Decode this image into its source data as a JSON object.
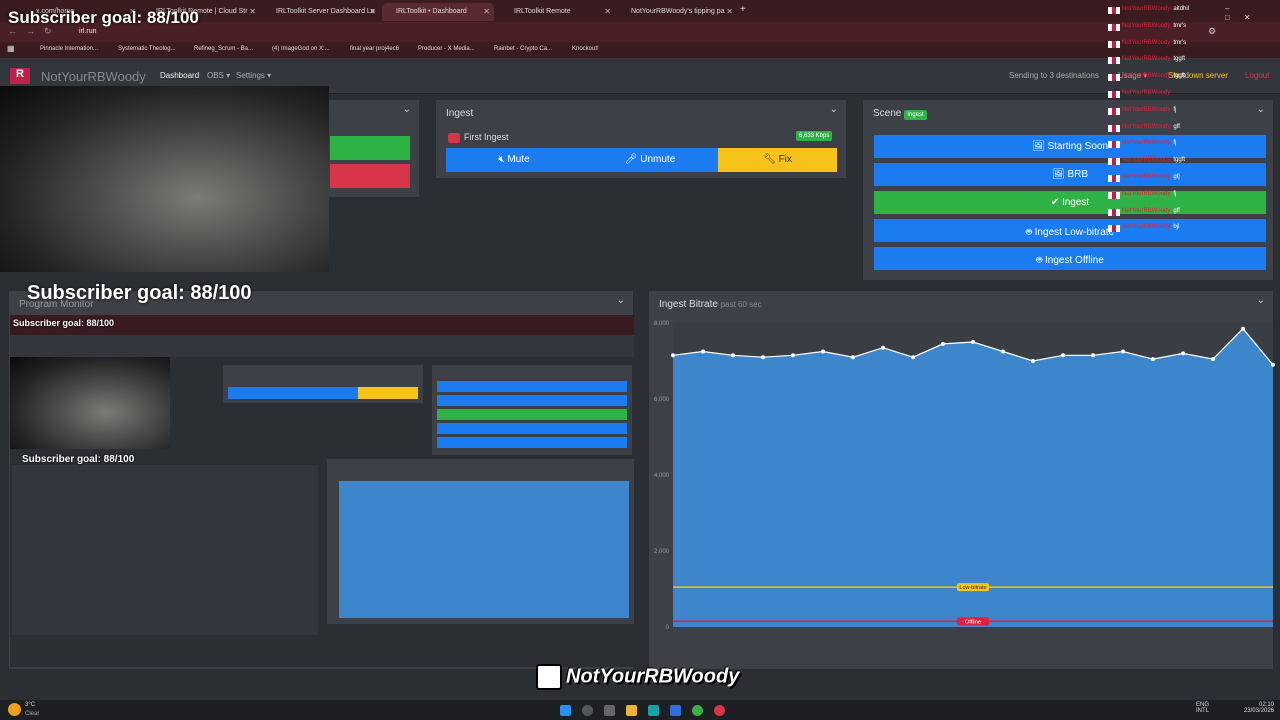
{
  "overlay": {
    "subscriber_goal": "Subscriber goal: 88/100"
  },
  "browser": {
    "tabs": [
      "x.com/home",
      "IRLToolkit Remote | Cloud Str",
      "IRLToolkit Server Dashboard Lo",
      "IRLToolkit • Dashboard",
      "IRLToolkit Remote",
      "NotYourRBWoody's tipping pa"
    ],
    "address": "irl.run",
    "bookmarks": [
      "Pinnacle Internation...",
      "Systematic Theolog...",
      "Refineg_Scrum - Ba...",
      "(4) ImageGod on X:...",
      "final year proj4ec6",
      "Producer - X Media...",
      "Rainbet - Crypto Ca...",
      "Knockout!"
    ]
  },
  "nav": {
    "brand": "NotYourRBWoody",
    "dashboard": "Dashboard",
    "obs": "OBS ▾",
    "settings": "Settings ▾",
    "sending": "Sending to 3 destinations",
    "usage": "Usage ▾",
    "shutdown": "Shutdown server",
    "logout": "Logout"
  },
  "ingest": {
    "title": "Ingest",
    "source": "First Ingest",
    "bitrate": "6,633 Kbps",
    "mute": "Mute",
    "unmute": "Unmute",
    "fix": "Fix"
  },
  "scene": {
    "title": "Scene",
    "badge": "Ingest",
    "buttons": [
      "Starting Soon",
      "BRB",
      "Ingest",
      "Ingest Low-bitrate",
      "Ingest Offline"
    ]
  },
  "program": {
    "title": "Program Monitor"
  },
  "bitrate": {
    "title": "Ingest Bitrate",
    "subtitle": "past 60 sec",
    "low_label": "Low-bitrate",
    "offline_label": "Offline"
  },
  "chart_data": {
    "type": "area",
    "title": "Ingest Bitrate",
    "yticks": [
      "8,000",
      "6,000",
      "4,000",
      "2,000",
      "0"
    ],
    "ylim": [
      0,
      8000
    ],
    "values": [
      7150,
      7250,
      7150,
      7100,
      7150,
      7250,
      7100,
      7350,
      7100,
      7450,
      7500,
      7250,
      7000,
      7150,
      7150,
      7250,
      7050,
      7200,
      7050,
      7850,
      6900
    ],
    "low_threshold": 1050,
    "offline_threshold": 150,
    "colors": {
      "fill": "#3d86cc",
      "line": "#ffffff",
      "low": "#f7c21a",
      "offline": "#e0203a"
    }
  },
  "chat": [
    {
      "name": "NotYourRBWoody",
      "msg": "aitdhil"
    },
    {
      "name": "NotYourRBWoody",
      "msg": "tmr's"
    },
    {
      "name": "NotYourRBWoody",
      "msg": "tmr's"
    },
    {
      "name": "NotYourRBWoody",
      "msg": "tggft"
    },
    {
      "name": "NotYourRBWoody",
      "msg": "tggft"
    },
    {
      "name": "NotYourRBWoody",
      "msg": ""
    },
    {
      "name": "NotYourRBWoody",
      "msg": "fj"
    },
    {
      "name": "NotYourRBWoody",
      "msg": "gff"
    },
    {
      "name": "NotYourRBWoody",
      "msg": "fj"
    },
    {
      "name": "NotYourRBWoody",
      "msg": "tggft"
    },
    {
      "name": "NotYourRBWoody",
      "msg": "gfj"
    },
    {
      "name": "NotYourRBWoody",
      "msg": "fj"
    },
    {
      "name": "NotYourRBWoody",
      "msg": "gff"
    },
    {
      "name": "NotYourRBWoody",
      "msg": "bjl"
    }
  ],
  "logo": {
    "text": "NotYourRBWoody"
  },
  "taskbar": {
    "weather_temp": "3°C",
    "weather_desc": "Clear",
    "lang1": "ENG",
    "lang2": "INTL",
    "time": "02:10",
    "date": "23/03/2026"
  }
}
